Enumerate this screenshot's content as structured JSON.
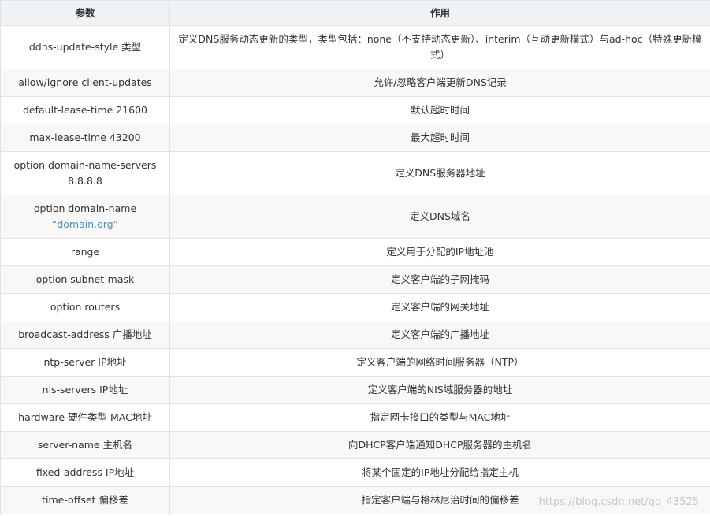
{
  "table": {
    "headers": [
      "参数",
      "作用"
    ],
    "rows": [
      {
        "param": "ddns-update-style 类型",
        "desc": "定义DNS服务动态更新的类型，类型包括：none（不支持动态更新）、interim（互动更新模式）与ad-hoc（特殊更新模式）",
        "tall": true
      },
      {
        "param": "allow/ignore client-updates",
        "desc": "允许/忽略客户端更新DNS记录"
      },
      {
        "param": "default-lease-time 21600",
        "desc": "默认超时时间"
      },
      {
        "param": "max-lease-time 43200",
        "desc": "最大超时时间"
      },
      {
        "param": "option domain-name-servers 8.8.8.8",
        "desc": "定义DNS服务器地址",
        "tall": true
      },
      {
        "param": "option domain-name",
        "param_link": "“domain.org”",
        "desc": "定义DNS域名",
        "tall": true
      },
      {
        "param": "range",
        "desc": "定义用于分配的IP地址池"
      },
      {
        "param": "option subnet-mask",
        "desc": "定义客户端的子网掩码"
      },
      {
        "param": "option routers",
        "desc": "定义客户端的网关地址"
      },
      {
        "param": "broadcast-address 广播地址",
        "desc": "定义客户端的广播地址"
      },
      {
        "param": "ntp-server IP地址",
        "desc": "定义客户端的网络时间服务器（NTP）"
      },
      {
        "param": "nis-servers IP地址",
        "desc": "定义客户端的NIS域服务器的地址"
      },
      {
        "param": "hardware 硬件类型 MAC地址",
        "desc": "指定网卡接口的类型与MAC地址"
      },
      {
        "param": "server-name 主机名",
        "desc": "向DHCP客户端通知DHCP服务器的主机名"
      },
      {
        "param": "fixed-address IP地址",
        "desc": "将某个固定的IP地址分配给指定主机"
      },
      {
        "param": "time-offset 偏移差",
        "desc": "指定客户端与格林尼治时间的偏移差"
      }
    ]
  },
  "watermark": "https://blog.csdn.net/qq_43525"
}
